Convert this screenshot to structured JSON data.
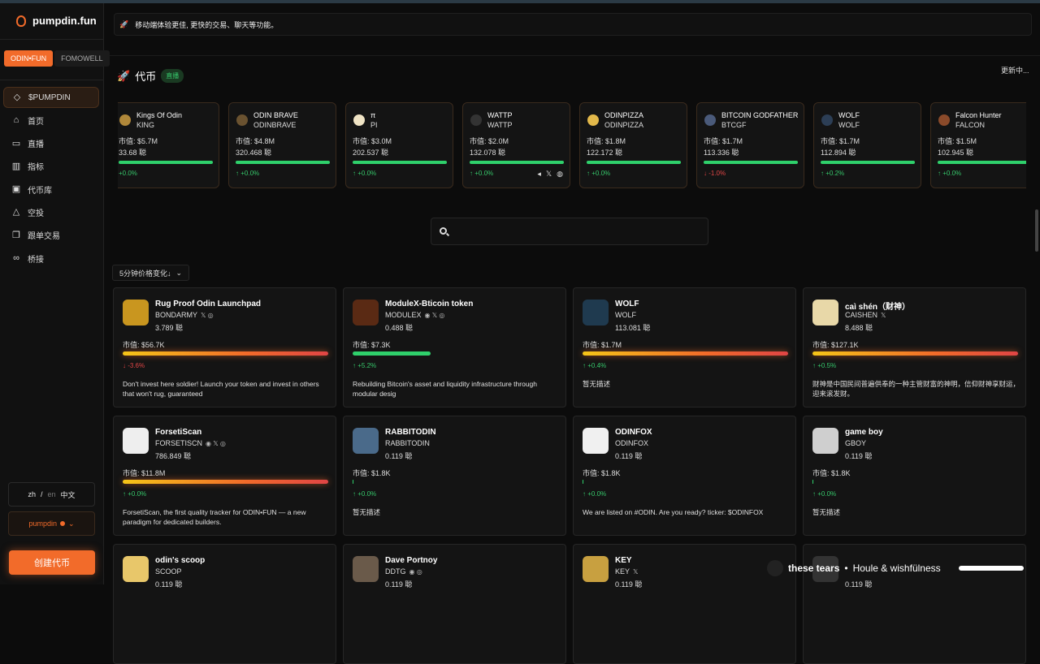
{
  "app": {
    "name": "pumpdin.fun"
  },
  "platform_tabs": [
    "ODIN•FUN",
    "FOMOWELL"
  ],
  "nav": [
    {
      "label": "$PUMPDIN",
      "icon": "diamond-icon",
      "active": true
    },
    {
      "label": "首页",
      "icon": "home-icon"
    },
    {
      "label": "直播",
      "icon": "video-icon"
    },
    {
      "label": "指标",
      "icon": "chart-icon"
    },
    {
      "label": "代币库",
      "icon": "library-icon"
    },
    {
      "label": "空投",
      "icon": "airdrop-icon"
    },
    {
      "label": "跟单交易",
      "icon": "copy-icon"
    },
    {
      "label": "桥接",
      "icon": "link-icon"
    }
  ],
  "lang": {
    "zh": "zh",
    "sep": "/",
    "en": "en",
    "current": "中文"
  },
  "user": {
    "name": "pumpdin"
  },
  "create_button": "创建代币",
  "notice": "移动端体验更佳, 更快的交易、聊天等功能。",
  "section": {
    "title": "代币",
    "badge": "直播",
    "status": "更新中..."
  },
  "ticker": [
    {
      "name": "Kings Of Odin",
      "symbol": "KING",
      "mc": "市值: $5.7M",
      "vol": "33.68 聪",
      "change": "+0.0%",
      "dir": "up",
      "color": "#b0883a"
    },
    {
      "name": "ODIN BRAVE",
      "symbol": "ODINBRAVE",
      "mc": "市值: $4.8M",
      "vol": "320.468 聪",
      "change": "↑ +0.0%",
      "dir": "up",
      "color": "#6a5230"
    },
    {
      "name": "π",
      "symbol": "PI",
      "mc": "市值: $3.0M",
      "vol": "202.537 聪",
      "change": "↑ +0.0%",
      "dir": "up",
      "color": "#efe3c4"
    },
    {
      "name": "WATTP",
      "symbol": "WATTP",
      "mc": "市值: $2.0M",
      "vol": "132.078 聪",
      "change": "↑ +0.0%",
      "dir": "up",
      "color": "#333"
    },
    {
      "name": "ODINPIZZA",
      "symbol": "ODINPIZZA",
      "mc": "市值: $1.8M",
      "vol": "122.172 聪",
      "change": "↑ +0.0%",
      "dir": "up",
      "color": "#e2b84a"
    },
    {
      "name": "BITCOIN GODFATHER",
      "symbol": "BTCGF",
      "mc": "市值: $1.7M",
      "vol": "113.336 聪",
      "change": "↓ -1.0%",
      "dir": "down",
      "color": "#4a5a7a"
    },
    {
      "name": "WOLF",
      "symbol": "WOLF",
      "mc": "市值: $1.7M",
      "vol": "112.894 聪",
      "change": "↑ +0.2%",
      "dir": "up",
      "color": "#2c3e55"
    },
    {
      "name": "Falcon Hunter",
      "symbol": "FALCON",
      "mc": "市值: $1.5M",
      "vol": "102.945 聪",
      "change": "↑ +0.0%",
      "dir": "up",
      "color": "#8a4a2a"
    }
  ],
  "sort_label": "5分钟价格变化↓",
  "cards": [
    {
      "name": "Rug Proof Odin Launchpad",
      "symbol": "BONDARMY",
      "socials": "𝕏 ◎",
      "vol": "3.789 聪",
      "mc": "市值: $56.7K",
      "change": "↓ -3.6%",
      "dir": "down",
      "bar_pct": 100,
      "bar_style": "orange",
      "desc": "Don't invest here soldier! Launch your token and invest in others that won't rug, guaranteed",
      "color": "#c9961f"
    },
    {
      "name": "ModuleX-Bticoin token",
      "symbol": "MODULEX",
      "socials": "◉ 𝕏 ◎",
      "vol": "0.488 聪",
      "mc": "市值: $7.3K",
      "change": "↑ +5.2%",
      "dir": "up",
      "bar_pct": 38,
      "bar_style": "green",
      "desc": "Rebuilding Bitcoin's asset and liquidity infrastructure through modular desig",
      "color": "#5a2a14"
    },
    {
      "name": "WOLF",
      "symbol": "WOLF",
      "socials": "",
      "vol": "113.081 聪",
      "mc": "市值: $1.7M",
      "change": "↑ +0.4%",
      "dir": "up",
      "bar_pct": 100,
      "bar_style": "orange",
      "desc": "暂无描述",
      "color": "#1f3a4f"
    },
    {
      "name": "caì shén（财神）",
      "symbol": "CAISHEN",
      "socials": "𝕏",
      "vol": "8.488 聪",
      "mc": "市值: $127.1K",
      "change": "↑ +0.5%",
      "dir": "up",
      "bar_pct": 100,
      "bar_style": "orange",
      "desc": "财神是中国民间普遍供奉的一种主管财富的神明，信仰财神享财运，迎来滚发财。",
      "color": "#e8d8a8"
    },
    {
      "name": "ForsetiScan",
      "symbol": "FORSETISCN",
      "socials": "◉ 𝕏 ◎",
      "vol": "786.849 聪",
      "mc": "市值: $11.8M",
      "change": "↑ +0.0%",
      "dir": "up",
      "bar_pct": 100,
      "bar_style": "orange",
      "desc": "ForsetiScan, the first quality tracker for ODIN•FUN — a new paradigm for dedicated builders.",
      "color": "#eeeeee"
    },
    {
      "name": "RABBITODIN",
      "symbol": "RABBITODIN",
      "socials": "",
      "vol": "0.119 聪",
      "mc": "市值: $1.8K",
      "change": "↑ +0.0%",
      "dir": "up",
      "bar_pct": 0.5,
      "bar_style": "green",
      "desc": "暂无描述",
      "color": "#4a6a8a"
    },
    {
      "name": "ODINFOX",
      "symbol": "ODINFOX",
      "socials": "",
      "vol": "0.119 聪",
      "mc": "市值: $1.8K",
      "change": "↑ +0.0%",
      "dir": "up",
      "bar_pct": 0.5,
      "bar_style": "green",
      "desc": "We are listed on #ODIN. Are you ready? ticker: $ODINFOX",
      "color": "#f0f0f0"
    },
    {
      "name": "game boy",
      "symbol": "GBOY",
      "socials": "",
      "vol": "0.119 聪",
      "mc": "市值: $1.8K",
      "change": "↑ +0.0%",
      "dir": "up",
      "bar_pct": 0.5,
      "bar_style": "green",
      "desc": "暂无描述",
      "color": "#cfcfcf"
    },
    {
      "name": "odin's scoop",
      "symbol": "SCOOP",
      "socials": "",
      "vol": "0.119 聪",
      "mc": "",
      "change": "",
      "dir": "up",
      "bar_pct": 0,
      "bar_style": "green",
      "desc": "",
      "color": "#e8c76a"
    },
    {
      "name": "Dave Portnoy",
      "symbol": "DDTG",
      "socials": "◉ ◎",
      "vol": "0.119 聪",
      "mc": "",
      "change": "",
      "dir": "up",
      "bar_pct": 0,
      "bar_style": "green",
      "desc": "",
      "color": "#6a5a4a"
    },
    {
      "name": "KEY",
      "symbol": "KEY",
      "socials": "𝕏",
      "vol": "0.119 聪",
      "mc": "",
      "change": "",
      "dir": "up",
      "bar_pct": 0,
      "bar_style": "green",
      "desc": "",
      "color": "#c8a040"
    },
    {
      "name": "",
      "symbol": "",
      "socials": "",
      "vol": "0.119 聪",
      "mc": "",
      "change": "",
      "dir": "up",
      "bar_pct": 0,
      "bar_style": "green",
      "desc": "",
      "color": "#333"
    }
  ],
  "player": {
    "title": "these tears",
    "sep": "•",
    "artist": "Houle & wishfülness",
    "progress": 0.3
  }
}
